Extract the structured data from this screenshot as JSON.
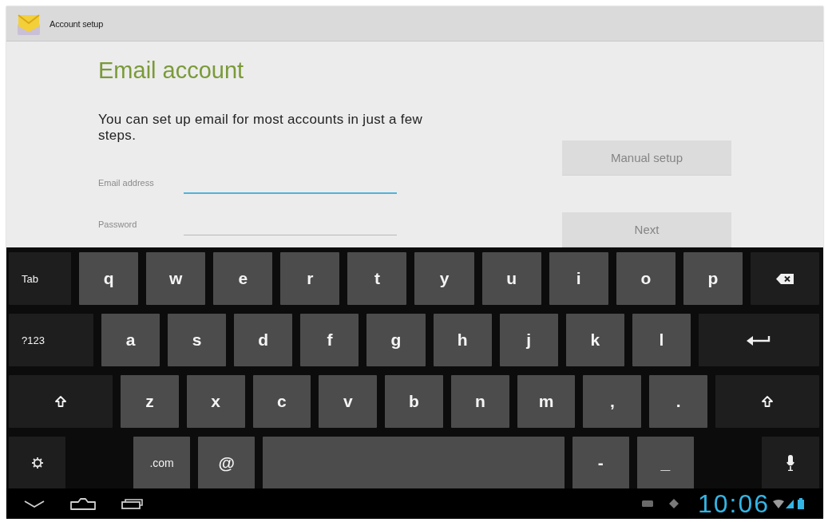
{
  "window": {
    "title": "Account setup"
  },
  "form": {
    "title": "Email account",
    "description": "You can set up email for most accounts in just a few steps.",
    "fields": [
      {
        "label": "Email address",
        "focused": true
      },
      {
        "label": "Password",
        "focused": false
      }
    ],
    "buttons": [
      {
        "label": "Manual setup",
        "disabled": true
      },
      {
        "label": "Next",
        "disabled": true
      }
    ]
  },
  "keyboard": {
    "rows": [
      [
        {
          "kind": "tab",
          "label": "Tab"
        },
        {
          "kind": "char",
          "label": "q"
        },
        {
          "kind": "char",
          "label": "w"
        },
        {
          "kind": "char",
          "label": "e"
        },
        {
          "kind": "char",
          "label": "r"
        },
        {
          "kind": "char",
          "label": "t"
        },
        {
          "kind": "char",
          "label": "y"
        },
        {
          "kind": "char",
          "label": "u"
        },
        {
          "kind": "char",
          "label": "i"
        },
        {
          "kind": "char",
          "label": "o"
        },
        {
          "kind": "char",
          "label": "p"
        },
        {
          "kind": "backspace"
        }
      ],
      [
        {
          "kind": "symbols",
          "label": "?123"
        },
        {
          "kind": "char",
          "label": "a"
        },
        {
          "kind": "char",
          "label": "s"
        },
        {
          "kind": "char",
          "label": "d"
        },
        {
          "kind": "char",
          "label": "f"
        },
        {
          "kind": "char",
          "label": "g"
        },
        {
          "kind": "char",
          "label": "h"
        },
        {
          "kind": "char",
          "label": "j"
        },
        {
          "kind": "char",
          "label": "k"
        },
        {
          "kind": "char",
          "label": "l"
        },
        {
          "kind": "enter"
        }
      ],
      [
        {
          "kind": "shift"
        },
        {
          "kind": "char",
          "label": "z"
        },
        {
          "kind": "char",
          "label": "x"
        },
        {
          "kind": "char",
          "label": "c"
        },
        {
          "kind": "char",
          "label": "v"
        },
        {
          "kind": "char",
          "label": "b"
        },
        {
          "kind": "char",
          "label": "n"
        },
        {
          "kind": "char",
          "label": "m"
        },
        {
          "kind": "char",
          "label": ","
        },
        {
          "kind": "char",
          "label": "."
        },
        {
          "kind": "shift"
        }
      ],
      [
        {
          "kind": "settings"
        },
        {
          "kind": "char",
          "label": ".com"
        },
        {
          "kind": "char",
          "label": "@"
        },
        {
          "kind": "space"
        },
        {
          "kind": "char",
          "label": "-"
        },
        {
          "kind": "char",
          "label": "_"
        },
        {
          "kind": "mic"
        }
      ]
    ]
  },
  "status_bar": {
    "time": "10:06"
  }
}
